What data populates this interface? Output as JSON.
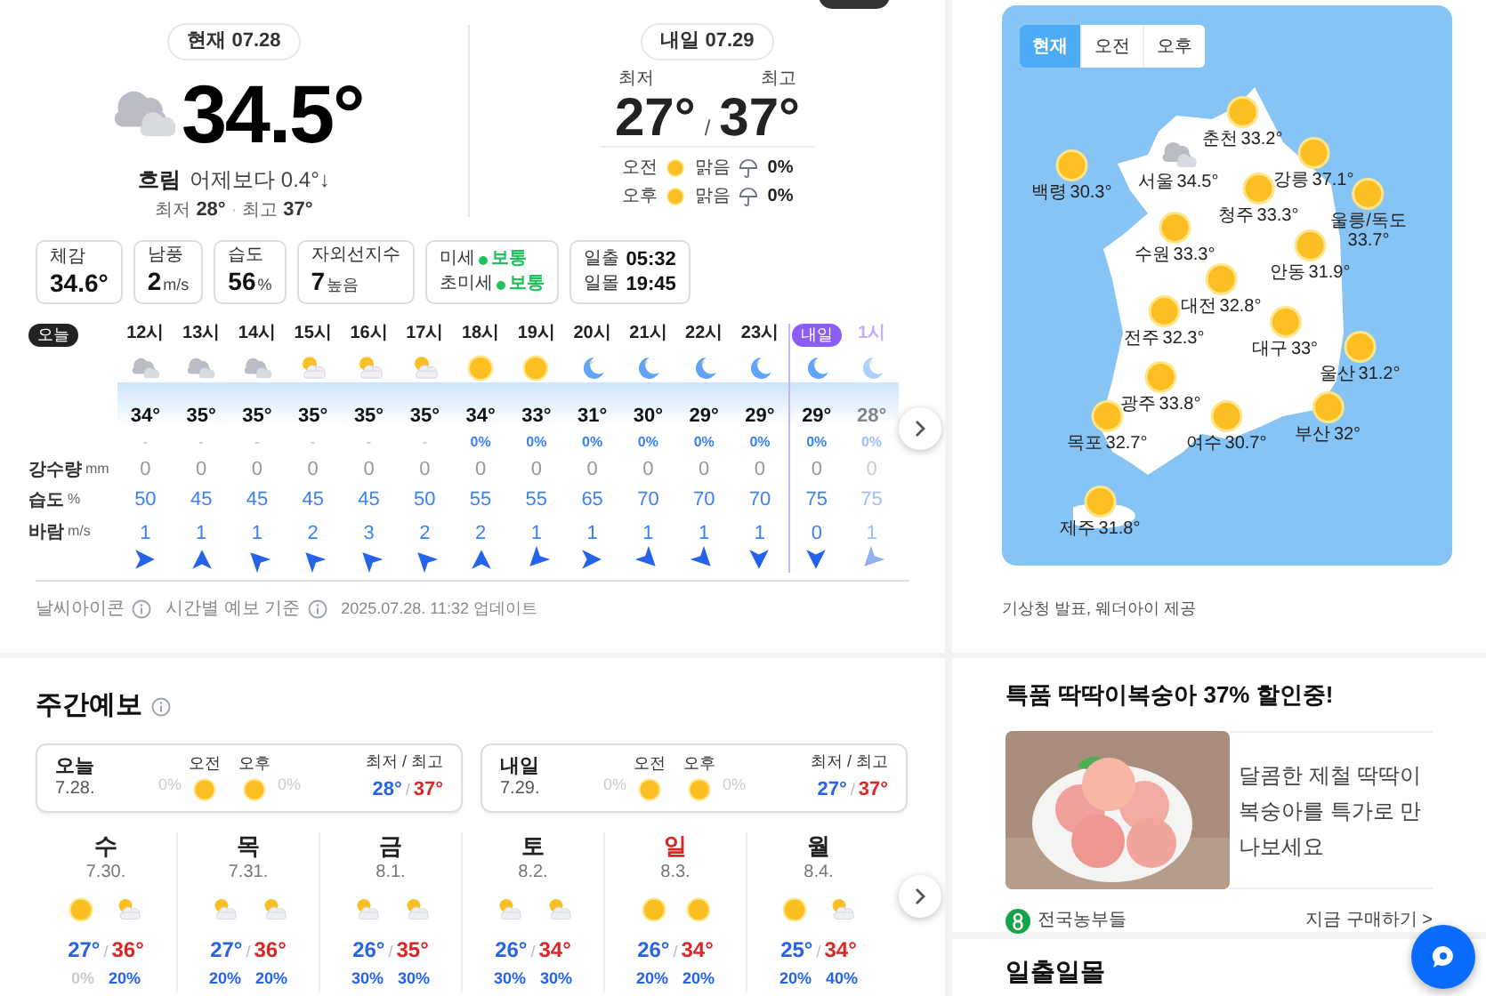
{
  "current": {
    "badge": "현재 07.28",
    "kind": "cloudy",
    "temp": "34.5°",
    "condition": "흐림",
    "compare": "어제보다 0.4°↓",
    "low_label": "최저",
    "low": "28°",
    "dot": "·",
    "high_label": "최고",
    "high": "37°"
  },
  "tomorrow": {
    "badge": "내일 07.29",
    "low_label": "최저",
    "high_label": "최고",
    "low": "27°",
    "slash": "/",
    "high": "37°",
    "periods": [
      {
        "label": "오전",
        "kind": "sunny",
        "condition": "맑음",
        "chance": "0%"
      },
      {
        "label": "오후",
        "kind": "sunny",
        "condition": "맑음",
        "chance": "0%"
      }
    ]
  },
  "details": [
    {
      "kind": "value",
      "label": "체감",
      "value": "34.6°"
    },
    {
      "kind": "value",
      "label": "남풍",
      "value": "2",
      "unit": "m/s"
    },
    {
      "kind": "value",
      "label": "습도",
      "value": "56",
      "unit": "%"
    },
    {
      "kind": "value",
      "label": "자외선지수",
      "value": "7",
      "unit": "높음"
    },
    {
      "kind": "status",
      "rows": [
        {
          "label": "미세",
          "status": "보통",
          "color": "#1fc35b"
        },
        {
          "label": "초미세",
          "status": "보통",
          "color": "#1fc35b"
        }
      ]
    },
    {
      "kind": "times",
      "rows": [
        {
          "label": "일출",
          "value": "05:32"
        },
        {
          "label": "일몰",
          "value": "19:45"
        }
      ]
    }
  ],
  "hourly": {
    "today_badge": "오늘",
    "row_labels": [
      {
        "label": "강수량",
        "unit": "mm"
      },
      {
        "label": "습도",
        "unit": "%"
      },
      {
        "label": "바람",
        "unit": "m/s"
      }
    ],
    "hours": [
      {
        "new_day": false,
        "label": "12시",
        "kind": "cloudy",
        "temp": "34°",
        "chance": "-",
        "chance_muted": true,
        "rain": "0",
        "humidity": "50",
        "wind": "1",
        "wind_arrow": {
          "kind": "E"
        },
        "faded": false
      },
      {
        "new_day": false,
        "label": "13시",
        "kind": "cloudy",
        "temp": "35°",
        "chance": "-",
        "chance_muted": true,
        "rain": "0",
        "humidity": "45",
        "wind": "1",
        "wind_arrow": {
          "kind": "N"
        },
        "faded": false
      },
      {
        "new_day": false,
        "label": "14시",
        "kind": "cloudy",
        "temp": "35°",
        "chance": "-",
        "chance_muted": true,
        "rain": "0",
        "humidity": "45",
        "wind": "1",
        "wind_arrow": {
          "kind": "NW"
        },
        "faded": false
      },
      {
        "new_day": false,
        "label": "15시",
        "kind": "partly",
        "temp": "35°",
        "chance": "-",
        "chance_muted": true,
        "rain": "0",
        "humidity": "45",
        "wind": "2",
        "wind_arrow": {
          "kind": "NW"
        },
        "faded": false
      },
      {
        "new_day": false,
        "label": "16시",
        "kind": "partly",
        "temp": "35°",
        "chance": "-",
        "chance_muted": true,
        "rain": "0",
        "humidity": "45",
        "wind": "3",
        "wind_arrow": {
          "kind": "NW"
        },
        "faded": false
      },
      {
        "new_day": false,
        "label": "17시",
        "kind": "partly",
        "temp": "35°",
        "chance": "-",
        "chance_muted": true,
        "rain": "0",
        "humidity": "50",
        "wind": "2",
        "wind_arrow": {
          "kind": "NW"
        },
        "faded": false
      },
      {
        "new_day": false,
        "label": "18시",
        "kind": "sunny",
        "temp": "34°",
        "chance": "0%",
        "chance_muted": false,
        "rain": "0",
        "humidity": "55",
        "wind": "2",
        "wind_arrow": {
          "kind": "N"
        },
        "faded": false
      },
      {
        "new_day": false,
        "label": "19시",
        "kind": "sunny",
        "temp": "33°",
        "chance": "0%",
        "chance_muted": false,
        "rain": "0",
        "humidity": "55",
        "wind": "1",
        "wind_arrow": {
          "kind": "SW"
        },
        "faded": false
      },
      {
        "new_day": false,
        "label": "20시",
        "kind": "moon",
        "temp": "31°",
        "chance": "0%",
        "chance_muted": false,
        "rain": "0",
        "humidity": "65",
        "wind": "1",
        "wind_arrow": {
          "kind": "E"
        },
        "faded": false
      },
      {
        "new_day": false,
        "label": "21시",
        "kind": "moon",
        "temp": "30°",
        "chance": "0%",
        "chance_muted": false,
        "rain": "0",
        "humidity": "70",
        "wind": "1",
        "wind_arrow": {
          "kind": "SE"
        },
        "faded": false
      },
      {
        "new_day": false,
        "label": "22시",
        "kind": "moon",
        "temp": "29°",
        "chance": "0%",
        "chance_muted": false,
        "rain": "0",
        "humidity": "70",
        "wind": "1",
        "wind_arrow": {
          "kind": "SE"
        },
        "faded": false
      },
      {
        "new_day": false,
        "label": "23시",
        "kind": "moon",
        "temp": "29°",
        "chance": "0%",
        "chance_muted": false,
        "rain": "0",
        "humidity": "70",
        "wind": "1",
        "wind_arrow": {
          "kind": "S"
        },
        "faded": false
      },
      {
        "new_day": true,
        "label": "내일",
        "kind": "moon",
        "temp": "29°",
        "chance": "0%",
        "chance_muted": false,
        "rain": "0",
        "humidity": "75",
        "wind": "0",
        "wind_arrow": {
          "kind": "S"
        },
        "faded": false
      },
      {
        "new_day": false,
        "label": "1시",
        "kind": "moon",
        "temp": "28°",
        "chance": "0%",
        "chance_muted": false,
        "rain": "0",
        "humidity": "75",
        "wind": "1",
        "wind_arrow": {
          "kind": "SW"
        },
        "faded": true
      }
    ]
  },
  "notes": {
    "icon_note": "날씨아이콘",
    "basis_note": "시간별 예보 기준",
    "updated": "2025.07.28. 11:32 업데이트"
  },
  "weekly": {
    "title": "주간예보",
    "summary": [
      {
        "day": "오늘",
        "date": "7.28.",
        "am": {
          "label": "오전",
          "kind": "sunny",
          "chance": "0%"
        },
        "pm": {
          "label": "오후",
          "kind": "sunny",
          "chance": "0%"
        },
        "range_label": "최저 / 최고",
        "low": "28°",
        "slash": "/",
        "high": "37°"
      },
      {
        "day": "내일",
        "date": "7.29.",
        "am": {
          "label": "오전",
          "kind": "sunny",
          "chance": "0%"
        },
        "pm": {
          "label": "오후",
          "kind": "sunny",
          "chance": "0%"
        },
        "range_label": "최저 / 최고",
        "low": "27°",
        "slash": "/",
        "high": "37°"
      }
    ],
    "days": [
      {
        "day": "수",
        "date": "7.30.",
        "holiday": false,
        "am": {
          "kind": "sunny",
          "chance": "0%",
          "muted": true
        },
        "pm": {
          "kind": "partly",
          "chance": "20%",
          "muted": false
        },
        "low": "27°",
        "slash": "/",
        "high": "36°"
      },
      {
        "day": "목",
        "date": "7.31.",
        "holiday": false,
        "am": {
          "kind": "partly",
          "chance": "20%",
          "muted": false
        },
        "pm": {
          "kind": "partly",
          "chance": "20%",
          "muted": false
        },
        "low": "27°",
        "slash": "/",
        "high": "36°"
      },
      {
        "day": "금",
        "date": "8.1.",
        "holiday": false,
        "am": {
          "kind": "partly",
          "chance": "30%",
          "muted": false
        },
        "pm": {
          "kind": "partly",
          "chance": "30%",
          "muted": false
        },
        "low": "26°",
        "slash": "/",
        "high": "35°"
      },
      {
        "day": "토",
        "date": "8.2.",
        "holiday": false,
        "am": {
          "kind": "partly",
          "chance": "30%",
          "muted": false
        },
        "pm": {
          "kind": "partly",
          "chance": "30%",
          "muted": false
        },
        "low": "26°",
        "slash": "/",
        "high": "34°"
      },
      {
        "day": "일",
        "date": "8.3.",
        "holiday": true,
        "am": {
          "kind": "sunny",
          "chance": "20%",
          "muted": false
        },
        "pm": {
          "kind": "sunny",
          "chance": "20%",
          "muted": false
        },
        "low": "26°",
        "slash": "/",
        "high": "34°"
      },
      {
        "day": "월",
        "date": "8.4.",
        "holiday": false,
        "am": {
          "kind": "sunny",
          "chance": "20%",
          "muted": false
        },
        "pm": {
          "kind": "partly",
          "chance": "40%",
          "muted": false
        },
        "low": "25°",
        "slash": "/",
        "high": "34°"
      }
    ]
  },
  "map": {
    "tabs": [
      {
        "label": "현재",
        "selected": true
      },
      {
        "label": "오전",
        "selected": false
      },
      {
        "label": "오후",
        "selected": false
      }
    ],
    "cities": [
      {
        "name": "춘천",
        "temp": "33.2°",
        "kind": "sunny"
      },
      {
        "name": "서울",
        "temp": "34.5°",
        "kind": "cloudy"
      },
      {
        "name": "백령",
        "temp": "30.3°",
        "kind": "sunny"
      },
      {
        "name": "강릉",
        "temp": "37.1°",
        "kind": "sunny"
      },
      {
        "name": "청주",
        "temp": "33.3°",
        "kind": "sunny"
      },
      {
        "name": "울릉/독도",
        "temp": "33.7°",
        "kind": "sunny"
      },
      {
        "name": "수원",
        "temp": "33.3°",
        "kind": "sunny"
      },
      {
        "name": "안동",
        "temp": "31.9°",
        "kind": "sunny"
      },
      {
        "name": "대전",
        "temp": "32.8°",
        "kind": "sunny"
      },
      {
        "name": "전주",
        "temp": "32.3°",
        "kind": "sunny"
      },
      {
        "name": "대구",
        "temp": "33°",
        "kind": "sunny"
      },
      {
        "name": "울산",
        "temp": "31.2°",
        "kind": "sunny"
      },
      {
        "name": "광주",
        "temp": "33.8°",
        "kind": "sunny"
      },
      {
        "name": "목포",
        "temp": "32.7°",
        "kind": "sunny"
      },
      {
        "name": "여수",
        "temp": "30.7°",
        "kind": "sunny"
      },
      {
        "name": "부산",
        "temp": "32°",
        "kind": "sunny"
      },
      {
        "name": "제주",
        "temp": "31.8°",
        "kind": "sunny"
      }
    ],
    "credit": "기상청 발표, 웨더아이 제공"
  },
  "ad": {
    "title": "특품 딱딱이복숭아 37% 할인중!",
    "description": "달콤한 제철 딱딱이 복숭아를 특가로 만나보세요",
    "seller": "전국농부들",
    "cta": "지금 구매하기 >"
  },
  "next_section": {
    "title": "일출일몰"
  }
}
